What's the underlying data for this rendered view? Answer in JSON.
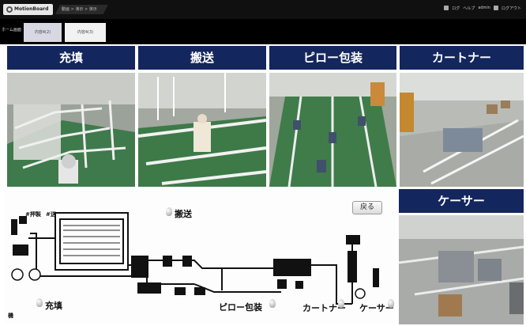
{
  "topbar": {
    "logo_text": "MotionBoard",
    "breadcrumb": "動画 > 演示 > 演示",
    "right_items": [
      "ログ",
      "ヘルプ",
      "admin",
      "ログアウト"
    ]
  },
  "tabs": {
    "home": "ホーム画面",
    "items": [
      {
        "label": "内容4(2)",
        "active": true
      },
      {
        "label": "内容4(3)",
        "active": false
      }
    ]
  },
  "cameras": [
    {
      "label": "充填"
    },
    {
      "label": "搬送"
    },
    {
      "label": "ピロー包装"
    },
    {
      "label": "カートナー"
    },
    {
      "label": "ケーサー"
    }
  ],
  "diagram": {
    "back_label": "戻る",
    "stations": [
      "搬送",
      "充填",
      "ピロー包装",
      "カートナー",
      "ケーサー"
    ],
    "small_labels": [
      "#押製",
      "#送",
      "機"
    ]
  },
  "colors": {
    "header_bg": "#14265e",
    "topbar_bg": "#101010"
  }
}
